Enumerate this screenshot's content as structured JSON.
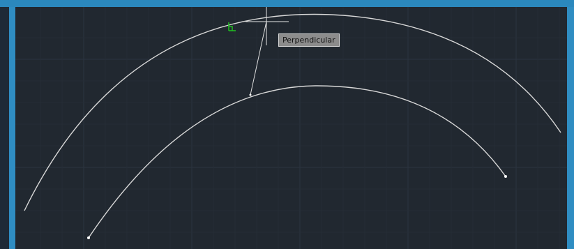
{
  "app": {
    "canvas_background": "#212830",
    "chrome_color": "#2b88bd"
  },
  "osnap": {
    "tooltip_label": "Perpendicular",
    "marker_color": "#20c020",
    "marker_icon": "perpendicular-snap-icon"
  },
  "drawing": {
    "entities": [
      "outer-arc",
      "inner-arc",
      "construction-line"
    ],
    "entity_color": "#d8d8d8"
  }
}
